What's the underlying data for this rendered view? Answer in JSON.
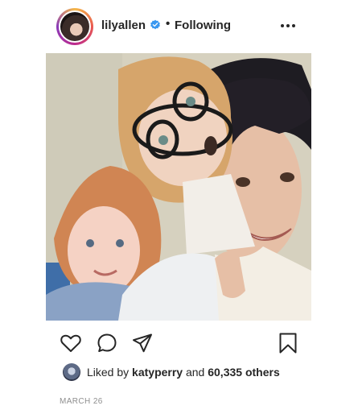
{
  "post": {
    "username": "lilyallen",
    "separator": "•",
    "follow_status": "Following",
    "liked_by_prefix": "Liked by",
    "liked_by_user": "katyperry",
    "liked_by_and": "and",
    "likes_others": "60,335 others",
    "date": "MARCH 26"
  },
  "icons": {
    "verified": "verified-badge-icon",
    "more": "more-options-icon",
    "like": "heart-icon",
    "comment": "comment-icon",
    "share": "share-icon",
    "save": "bookmark-icon"
  },
  "colors": {
    "verified_blue": "#3897f0",
    "text": "#262626",
    "muted": "#8e8e8e"
  }
}
